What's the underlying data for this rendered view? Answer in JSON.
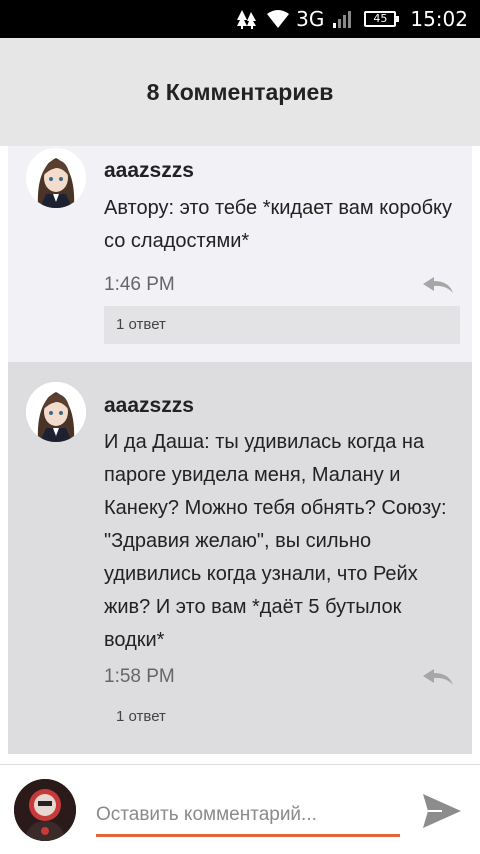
{
  "status_bar": {
    "network": "3G",
    "battery": "45",
    "time": "15:02"
  },
  "header": {
    "title": "8 Комментариев"
  },
  "comments": [
    {
      "author": "aaazszzs",
      "text": "Автору: это тебе *кидает вам коробку со сладостями*",
      "time": "1:46 PM",
      "replies": "1 ответ"
    },
    {
      "author": "aaazszzs",
      "text": "И да Даша: ты удивилась когда на пароге увидела меня, Малану и Канеку? Можно тебя обнять? Союзу: \"Здравия желаю\", вы сильно удивились когда узнали, что Рейх жив? И это вам *даёт 5 бутылок водки*",
      "time": "1:58 PM",
      "replies": "1 ответ"
    }
  ],
  "footer": {
    "input_placeholder": "Оставить комментарий..."
  },
  "colors": {
    "input_underline": "#e0663a",
    "header_bg": "#e6e6e6"
  },
  "icons": [
    "tree-icon",
    "wifi-icon",
    "signal-icon",
    "battery-icon",
    "reply-icon",
    "send-icon"
  ]
}
